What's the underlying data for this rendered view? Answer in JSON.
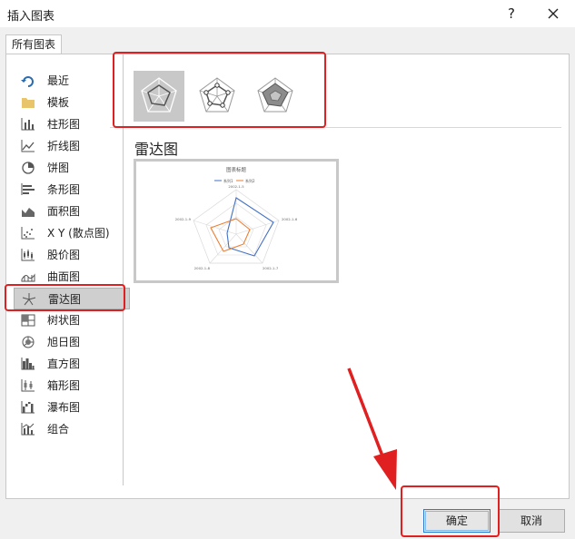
{
  "window": {
    "title": "插入图表",
    "help_glyph": "?",
    "close_icon": "close-icon"
  },
  "tabs": [
    {
      "label": "所有图表"
    }
  ],
  "sidebar": {
    "items": [
      {
        "label": "最近",
        "icon": "recent-icon"
      },
      {
        "label": "模板",
        "icon": "folder-icon"
      },
      {
        "label": "柱形图",
        "icon": "column-chart-icon"
      },
      {
        "label": "折线图",
        "icon": "line-chart-icon"
      },
      {
        "label": "饼图",
        "icon": "pie-chart-icon"
      },
      {
        "label": "条形图",
        "icon": "bar-chart-icon"
      },
      {
        "label": "面积图",
        "icon": "area-chart-icon"
      },
      {
        "label": "X Y (散点图)",
        "icon": "scatter-chart-icon"
      },
      {
        "label": "股价图",
        "icon": "stock-chart-icon"
      },
      {
        "label": "曲面图",
        "icon": "surface-chart-icon"
      },
      {
        "label": "雷达图",
        "icon": "radar-chart-icon",
        "selected": true
      },
      {
        "label": "树状图",
        "icon": "treemap-chart-icon"
      },
      {
        "label": "旭日图",
        "icon": "sunburst-chart-icon"
      },
      {
        "label": "直方图",
        "icon": "histogram-chart-icon"
      },
      {
        "label": "箱形图",
        "icon": "box-whisker-chart-icon"
      },
      {
        "label": "瀑布图",
        "icon": "waterfall-chart-icon"
      },
      {
        "label": "组合",
        "icon": "combo-chart-icon"
      }
    ]
  },
  "subtypes": [
    {
      "icon": "radar-icon",
      "selected": true
    },
    {
      "icon": "radar-with-markers-icon",
      "selected": false
    },
    {
      "icon": "filled-radar-icon",
      "selected": false
    }
  ],
  "main": {
    "type_title": "雷达图"
  },
  "preview": {
    "chart_title": "图表标题",
    "legend": [
      "系列1",
      "系列2"
    ],
    "axis_labels": [
      "2002-1-5",
      "2002-1-6",
      "2002-1-7",
      "2002-1-8",
      "2002-1-9"
    ],
    "colors": {
      "series1": "#4472c4",
      "series2": "#ed7d31"
    }
  },
  "footer": {
    "ok_label": "确定",
    "cancel_label": "取消"
  },
  "annotation_color": "#e02020"
}
